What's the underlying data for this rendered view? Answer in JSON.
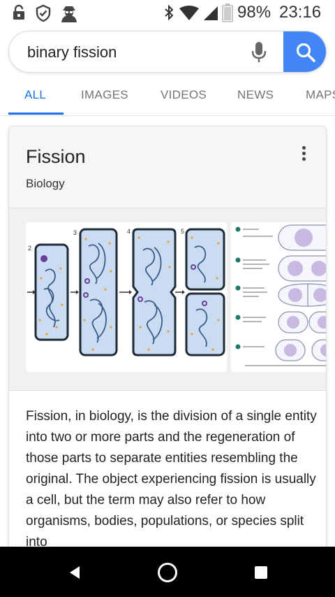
{
  "status_bar": {
    "battery_percent": "98%",
    "time": "23:16",
    "icons": [
      "lock-icon",
      "shield-icon",
      "incognito-icon",
      "bluetooth-icon",
      "wifi-icon",
      "signal-icon",
      "battery-icon"
    ]
  },
  "search": {
    "query": "binary fission",
    "mic_icon": "mic-icon",
    "search_icon": "search-icon",
    "accent_color": "#4285f4"
  },
  "tabs": [
    {
      "label": "ALL",
      "active": true
    },
    {
      "label": "IMAGES",
      "active": false
    },
    {
      "label": "VIDEOS",
      "active": false
    },
    {
      "label": "NEWS",
      "active": false
    },
    {
      "label": "MAPS",
      "active": false
    }
  ],
  "knowledge_card": {
    "title": "Fission",
    "subtitle": "Biology",
    "menu_icon": "more-vert-icon",
    "diagram_step_numbers": [
      "2",
      "3",
      "4",
      "5"
    ],
    "description": "Fission, in biology, is the division of a single entity into two or more parts and the regeneration of those parts to separate entities resembling the original. The object experiencing fission is usually a cell, but the term may also refer to how organisms, bodies, populations, or species split into"
  },
  "nav_bar": {
    "icons": [
      "back-icon",
      "home-icon",
      "recents-icon"
    ]
  }
}
